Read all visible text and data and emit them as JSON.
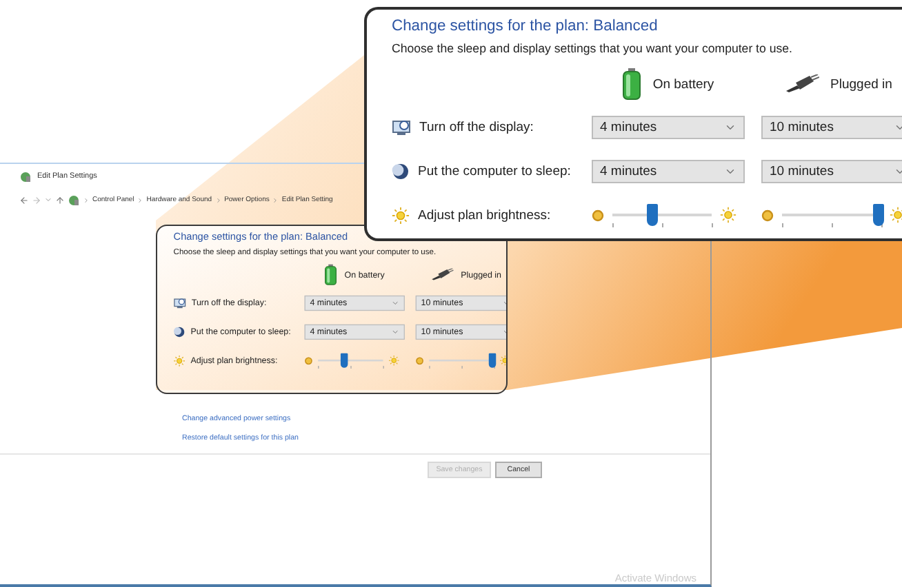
{
  "window": {
    "title": "Edit Plan Settings"
  },
  "breadcrumb": [
    "Control Panel",
    "Hardware and Sound",
    "Power Options",
    "Edit Plan Setting"
  ],
  "panel": {
    "title": "Change settings for the plan: Balanced",
    "description": "Choose the sleep and display settings that you want your computer to use.",
    "columns": [
      "On battery",
      "Plugged in"
    ],
    "rows": [
      {
        "kind": "dropdown",
        "label": "Turn off the display:",
        "values": [
          "4 minutes",
          "10 minutes"
        ]
      },
      {
        "kind": "dropdown",
        "label": "Put the computer to sleep:",
        "values": [
          "4 minutes",
          "10 minutes"
        ]
      },
      {
        "kind": "slider",
        "label": "Adjust plan brightness:",
        "sliders": [
          {
            "level": 0.4
          },
          {
            "level": 0.97
          }
        ]
      }
    ]
  },
  "links": [
    "Change advanced power settings",
    "Restore default settings for this plan"
  ],
  "buttons": [
    {
      "label": "Save changes",
      "disabled": true
    },
    {
      "label": "Cancel",
      "disabled": false
    }
  ],
  "callout": {
    "title": "Change settings for the plan: Balanced",
    "description": "Choose the sleep and display settings that you want your computer to use.",
    "columns": [
      "On battery",
      "Plugged in"
    ],
    "rows": [
      {
        "kind": "dropdown",
        "label": "Turn off the display:",
        "values": [
          "4 minutes",
          "10 minutes"
        ]
      },
      {
        "kind": "dropdown",
        "label": "Put the computer to sleep:",
        "values": [
          "4 minutes",
          "10 minutes"
        ]
      },
      {
        "kind": "slider",
        "label": "Adjust plan brightness:",
        "sliders": [
          {
            "level": 0.4
          },
          {
            "level": 0.97
          }
        ]
      }
    ]
  },
  "activation_notice": "Activate Windows"
}
